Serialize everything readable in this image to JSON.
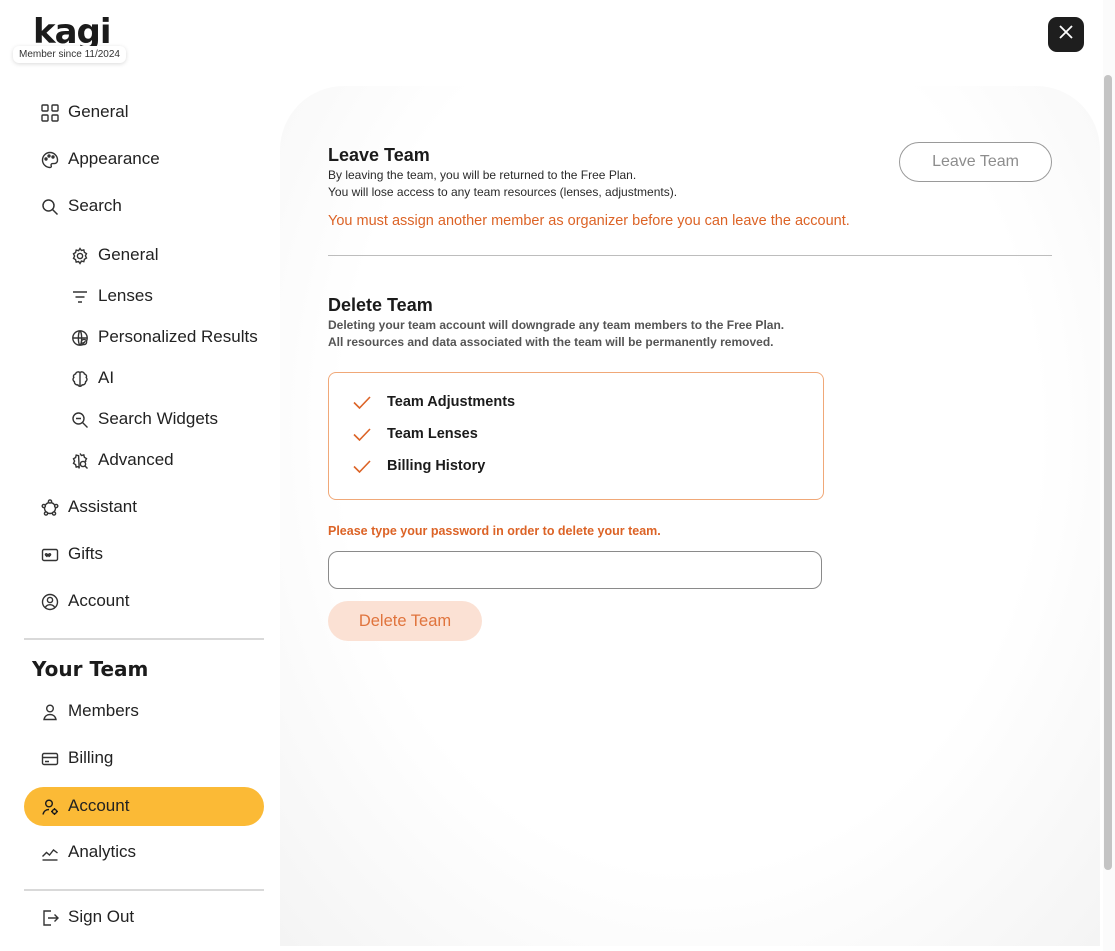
{
  "brand": {
    "logo": "kagi",
    "member_since": "Member since 11/2024"
  },
  "sidebar": {
    "items": [
      {
        "label": "General",
        "icon": "grid-icon"
      },
      {
        "label": "Appearance",
        "icon": "palette-icon"
      },
      {
        "label": "Search",
        "icon": "search-icon"
      },
      {
        "label": "General",
        "icon": "gear-icon"
      },
      {
        "label": "Lenses",
        "icon": "filter-icon"
      },
      {
        "label": "Personalized Results",
        "icon": "globe-icon"
      },
      {
        "label": "AI",
        "icon": "brain-icon"
      },
      {
        "label": "Search Widgets",
        "icon": "search-widget-icon"
      },
      {
        "label": "Advanced",
        "icon": "advanced-gear-icon"
      },
      {
        "label": "Assistant",
        "icon": "assistant-icon"
      },
      {
        "label": "Gifts",
        "icon": "gift-icon"
      },
      {
        "label": "Account",
        "icon": "account-circle-icon"
      }
    ],
    "team_heading": "Your Team",
    "team_items": [
      {
        "label": "Members",
        "icon": "person-icon"
      },
      {
        "label": "Billing",
        "icon": "card-icon"
      },
      {
        "label": "Account",
        "icon": "person-gear-icon",
        "active": true
      },
      {
        "label": "Analytics",
        "icon": "chart-line-icon"
      }
    ],
    "sign_out": {
      "label": "Sign Out",
      "icon": "sign-out-icon"
    }
  },
  "leave": {
    "title": "Leave Team",
    "desc_line1": "By leaving the team, you will be returned to the Free Plan.",
    "desc_line2": "You will lose access to any team resources (lenses, adjustments).",
    "warning": "You must assign another member as organizer before you can leave the account.",
    "button": "Leave Team"
  },
  "delete": {
    "title": "Delete Team",
    "desc_line1": "Deleting your team account will downgrade any team members to the Free Plan.",
    "desc_line2": "All resources and data associated with the team will be permanently removed.",
    "resources": [
      "Team Adjustments",
      "Team Lenses",
      "Billing History"
    ],
    "password_label": "Please type your password in order to delete your team.",
    "password_value": "",
    "button": "Delete Team"
  },
  "colors": {
    "accent": "#fbba36",
    "warning": "#dc6326",
    "delete_bg": "#fbe1d4"
  }
}
